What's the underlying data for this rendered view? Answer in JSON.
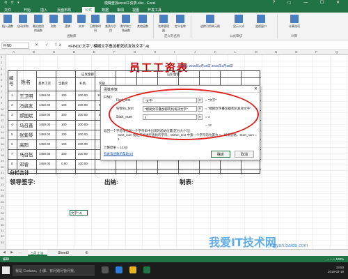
{
  "window": {
    "title": "模糊查找excel工资表.xlsx - Excel",
    "quick_access": "⟲ ⟳ ▾",
    "controls": "? ▭ — ☐ ✕"
  },
  "ribbon_tabs": [
    "文件",
    "开始",
    "插入",
    "页面布局",
    "公式",
    "数据",
    "审阅",
    "视图",
    "开发工具"
  ],
  "active_tab": "公式",
  "ribbon_buttons": [
    "插入函数",
    "自动求和",
    "最近使用的函数",
    "财务",
    "逻辑",
    "文本",
    "日期和时间",
    "查找与引用",
    "数学和三角函数",
    "其他函数",
    "名称管理器",
    "定义名称",
    "追踪引用单元格",
    "显示公式",
    "监视窗口",
    "计算选项"
  ],
  "ribbon_groups": [
    "函数库",
    "定义的名称",
    "公式审核",
    "计算"
  ],
  "formula_bar": {
    "name_box": "FIND",
    "icons": "✕ ✓ fx",
    "formula": "=FIND(\"文字\",\"模糊文字叠加都死机发效文字\",4)"
  },
  "columns": [
    "A",
    "B",
    "C",
    "D",
    "E",
    "F",
    "G",
    "H",
    "I",
    "J",
    "K",
    "L",
    "M",
    "N",
    "O",
    "P",
    "Q"
  ],
  "rows": [
    "1",
    "2",
    "3",
    "4",
    "5",
    "6",
    "7",
    "8",
    "9",
    "10",
    "11",
    "12",
    "13",
    "14",
    "15",
    "16",
    "17",
    "18",
    "19",
    "20",
    "21",
    "22",
    "23",
    "24",
    "25",
    "26",
    "27",
    "28",
    "29",
    "30",
    "31",
    "32",
    "33"
  ],
  "sheet": {
    "title": "员工工资表",
    "date_line": "日期: 2015年2月18日    2015年2月18日",
    "header_bianhao": "编号",
    "header_name": "姓名",
    "group1": "应发金额",
    "group2": "应扣金额",
    "subheaders": [
      "基本工资",
      "全勤奖",
      "补助",
      "奖励"
    ],
    "names": [
      "王卫明",
      "冯启友",
      "郝国斌",
      "马召鑫",
      "张紫琴",
      "高阳",
      "马召伍",
      "邓睿"
    ],
    "numbers": [
      "1",
      "2",
      "3",
      "4",
      "5",
      "6",
      "7",
      "8"
    ],
    "row_values": [
      [
        "1450.00",
        "100",
        "200.00",
        "1000.00"
      ],
      [
        "1450.00",
        "100",
        "200.00",
        "900.00"
      ],
      [
        "1450.00",
        "100",
        "200.00",
        "600.00"
      ],
      [
        "1450.00",
        "100",
        "200.00",
        ""
      ],
      [
        "1450.00",
        "100",
        "200.00",
        ""
      ],
      [
        "1450.00",
        "100",
        "200.00",
        ""
      ],
      [
        "1450.00",
        "100",
        "200.00",
        ""
      ],
      [
        "1450.00",
        "0.00",
        "100.00",
        ""
      ]
    ],
    "total_label": "分栏合计",
    "footer": {
      "sign": "领导签字:",
      "cashier": "出纳:",
      "maker": "制表:"
    }
  },
  "dialog": {
    "title": "函数参数",
    "close": "✕",
    "function_name": "FIND",
    "args": [
      {
        "label": "Find_text",
        "value": "\"文字\"",
        "result": "= \"文字\""
      },
      {
        "label": "Within_text",
        "value": "\"模糊文字叠加都死机发效文字\"",
        "result": "= \"模糊文字叠加都死机发效文字\""
      },
      {
        "label": "Start_num",
        "value": "4",
        "result": "= 4"
      }
    ],
    "eval_result": "= 12",
    "description": "返回一个字符串在另一个字符串中出现的起始位置(区分大小写)",
    "arg_help": "Start_num 指定开始进行查找的字符。Within_text 中第一个字符的位置为 1。如果忽略，Start_num = 1",
    "calc_result": "计算结果 = 12.00",
    "help_link": "有关该函数的帮助(H)",
    "ok": "确定",
    "cancel": "取消"
  },
  "cell_preview": "文字\",4)",
  "sheet_tabs": [
    "5月工资",
    "Sheet3"
  ],
  "sheet_nav": "◀ ▶ …",
  "add_sheet": "⊕",
  "status": {
    "mode": "编辑",
    "zoom": "─  ─  +  100%"
  },
  "taskbar": {
    "search": "我是 Cortana，小娜。有问题尽管问我。",
    "time": "19:50",
    "date": "2016-02-19"
  },
  "watermark": {
    "main": "我爱IT技术网",
    "url": "jingyan.baidu.com"
  },
  "colors": {
    "excel_green": "#217346",
    "title_red": "#c00000",
    "annotation_red": "#e02020"
  }
}
